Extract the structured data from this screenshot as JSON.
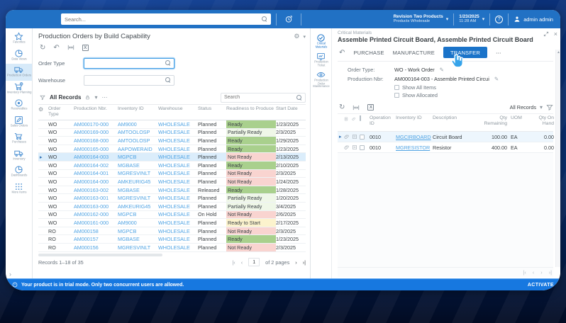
{
  "icons": {
    "gear": "⚙",
    "chevron_down": "▾",
    "refresh": "↻",
    "undo": "↶",
    "ellipsis": "⋯",
    "close": "×",
    "help": "?",
    "caret_right": "▸",
    "pencil": "✎",
    "excel": "X",
    "pager_first": "|‹",
    "pager_prev": "‹",
    "pager_next": "›",
    "pager_last": "›|",
    "scroll_up": "▲",
    "sidebar_expand": "›"
  },
  "topbar": {
    "search_placeholder": "Search...",
    "company_line1": "Revision Two Products",
    "company_line2": "Products Wholesale",
    "date": "1/23/2025",
    "time": "11:28 AM",
    "user": "admin admin"
  },
  "sidebar": {
    "items": [
      {
        "label": "Favorites",
        "icon": "star"
      },
      {
        "label": "Data Views",
        "icon": "pie"
      },
      {
        "label": "Production Orders",
        "icon": "truck",
        "selected": true
      },
      {
        "label": "Inventory Planning",
        "icon": "cartclock"
      },
      {
        "label": "Receivables",
        "icon": "target"
      },
      {
        "label": "Sales Orders",
        "icon": "pencilsq"
      },
      {
        "label": "Purchases",
        "icon": "cart"
      },
      {
        "label": "Inventory",
        "icon": "truck"
      },
      {
        "label": "Dashboards",
        "icon": "pie"
      },
      {
        "label": "More Items",
        "icon": "grid"
      }
    ]
  },
  "left_panel": {
    "title": "Production Orders by Build Capability",
    "order_type_label": "Order Type",
    "warehouse_label": "Warehouse",
    "filter_label": "All Records",
    "search_placeholder": "Search",
    "table": {
      "columns": [
        "Order Type",
        "Production Nbr.",
        "Inventory ID",
        "Warehouse",
        "Status",
        "Readiness to Produce",
        "Start Date"
      ],
      "rows": [
        {
          "type": "WO",
          "nbr": "AM000170-000",
          "inventory": "AM9000",
          "warehouse": "WHOLESALE",
          "status": "Planned",
          "readiness": "Ready",
          "level": "ready",
          "date": "1/23/2025"
        },
        {
          "type": "WO",
          "nbr": "AM000169-000",
          "inventory": "AMTOOLOSP",
          "warehouse": "WHOLESALE",
          "status": "Planned",
          "readiness": "Partially Ready",
          "level": "partial",
          "date": "2/3/2025"
        },
        {
          "type": "WO",
          "nbr": "AM000168-000",
          "inventory": "AMTOOLOSP",
          "warehouse": "WHOLESALE",
          "status": "Planned",
          "readiness": "Ready",
          "level": "ready",
          "date": "1/29/2025"
        },
        {
          "type": "WO",
          "nbr": "AM000165-000",
          "inventory": "AAPOWERAID",
          "warehouse": "WHOLESALE",
          "status": "Planned",
          "readiness": "Ready",
          "level": "ready",
          "date": "1/23/2025"
        },
        {
          "type": "WO",
          "nbr": "AM000164-003",
          "inventory": "MGPCB",
          "warehouse": "WHOLESALE",
          "status": "Planned",
          "readiness": "Not Ready",
          "level": "not",
          "date": "2/13/2025",
          "selected": true
        },
        {
          "type": "WO",
          "nbr": "AM000164-002",
          "inventory": "MGBASE",
          "warehouse": "WHOLESALE",
          "status": "Planned",
          "readiness": "Ready",
          "level": "ready",
          "date": "2/10/2025"
        },
        {
          "type": "WO",
          "nbr": "AM000164-001",
          "inventory": "MGRESVINLT",
          "warehouse": "WHOLESALE",
          "status": "Planned",
          "readiness": "Not Ready",
          "level": "not",
          "date": "2/3/2025"
        },
        {
          "type": "WO",
          "nbr": "AM000164-000",
          "inventory": "AMKEURIG45",
          "warehouse": "WHOLESALE",
          "status": "Planned",
          "readiness": "Not Ready",
          "level": "not",
          "date": "1/24/2025"
        },
        {
          "type": "WO",
          "nbr": "AM000163-002",
          "inventory": "MGBASE",
          "warehouse": "WHOLESALE",
          "status": "Released",
          "readiness": "Ready",
          "level": "ready",
          "date": "1/28/2025"
        },
        {
          "type": "WO",
          "nbr": "AM000163-001",
          "inventory": "MGRESVINLT",
          "warehouse": "WHOLESALE",
          "status": "Planned",
          "readiness": "Partially Ready",
          "level": "partial",
          "date": "1/20/2025"
        },
        {
          "type": "WO",
          "nbr": "AM000163-000",
          "inventory": "AMKEURIG45",
          "warehouse": "WHOLESALE",
          "status": "Planned",
          "readiness": "Partially Ready",
          "level": "partial",
          "date": "3/4/2025"
        },
        {
          "type": "WO",
          "nbr": "AM000162-000",
          "inventory": "MGPCB",
          "warehouse": "WHOLESALE",
          "status": "On Hold",
          "readiness": "Not Ready",
          "level": "not",
          "date": "2/6/2025"
        },
        {
          "type": "WO",
          "nbr": "AM000161-000",
          "inventory": "AM9000",
          "warehouse": "WHOLESALE",
          "status": "Planned",
          "readiness": "Ready to Start",
          "level": "start",
          "date": "2/17/2025"
        },
        {
          "type": "RO",
          "nbr": "AM000158",
          "inventory": "MGPCB",
          "warehouse": "WHOLESALE",
          "status": "Planned",
          "readiness": "Not Ready",
          "level": "not",
          "date": "2/3/2025"
        },
        {
          "type": "RO",
          "nbr": "AM000157",
          "inventory": "MGBASE",
          "warehouse": "WHOLESALE",
          "status": "Planned",
          "readiness": "Ready",
          "level": "ready",
          "date": "1/23/2025"
        },
        {
          "type": "RO",
          "nbr": "AM000156",
          "inventory": "MGRESVINLT",
          "warehouse": "WHOLESALE",
          "status": "Planned",
          "readiness": "Not Ready",
          "level": "not",
          "date": "2/3/2025"
        }
      ]
    },
    "footer": {
      "records": "Records 1–18 of 35",
      "page_current": "1",
      "pages_label": "of 2 pages"
    }
  },
  "right_panel": {
    "breadcrumb": "Critical Materials",
    "title": "Assemble Printed Circuit Board, Assemble Printed Circuit Board",
    "actions": {
      "purchase": "PURCHASE",
      "manufacture": "MANUFACTURE",
      "transfer": "TRANSFER"
    },
    "side_items": [
      {
        "label": "Critical Materials",
        "icon": "checkcircle",
        "selected": true
      },
      {
        "label": "Production Ticket",
        "icon": "monitor"
      },
      {
        "label": "Production Order Maintenance",
        "icon": "eye"
      }
    ],
    "form": {
      "order_type_label": "Order Type:",
      "order_type_value": "WO - Work Order",
      "production_nbr_label": "Production Nbr:",
      "production_nbr_value": "AM000164-003 - Assemble Printed Circui",
      "show_all_items": "Show All Items",
      "show_allocated": "Show Allocated"
    },
    "records_filter": "All Records",
    "table": {
      "columns": [
        "Operation ID",
        "Inventory ID",
        "Description",
        "Qty Remaining",
        "UOM",
        "Qty On Hand"
      ],
      "rows": [
        {
          "operation": "0010",
          "inventory": "MGCIRBOARD",
          "description": "Circuit Board",
          "qty_remaining": "100.00",
          "uom": "EA",
          "qty_on_hand": "0.00",
          "selected": true
        },
        {
          "operation": "0010",
          "inventory": "MGRESISTOR",
          "description": "Resistor",
          "qty_remaining": "400.00",
          "uom": "EA",
          "qty_on_hand": "0.00"
        }
      ]
    }
  },
  "trial_bar": {
    "message": "Your product is in trial mode. Only two concurrent users are allowed.",
    "action": "ACTIVATE"
  }
}
